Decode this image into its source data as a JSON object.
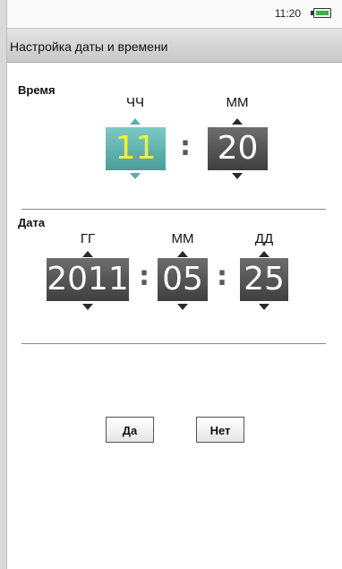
{
  "status_bar": {
    "time": "11:20"
  },
  "window": {
    "title": "Настройка даты и времени"
  },
  "time_section": {
    "label": "Время",
    "hours": {
      "label": "ЧЧ",
      "value": "11"
    },
    "minutes": {
      "label": "ММ",
      "value": "20"
    },
    "separator": ":"
  },
  "date_section": {
    "label": "Дата",
    "year": {
      "label": "ГГ",
      "value": "2011"
    },
    "month": {
      "label": "ММ",
      "value": "05"
    },
    "day": {
      "label": "ДД",
      "value": "25"
    },
    "separator": ":"
  },
  "buttons": {
    "yes": "Да",
    "no": "Нет"
  },
  "colors": {
    "active_field_bg": "#6bbab6",
    "active_field_text": "#f1ef3a",
    "inactive_field_bg": "#555555"
  }
}
